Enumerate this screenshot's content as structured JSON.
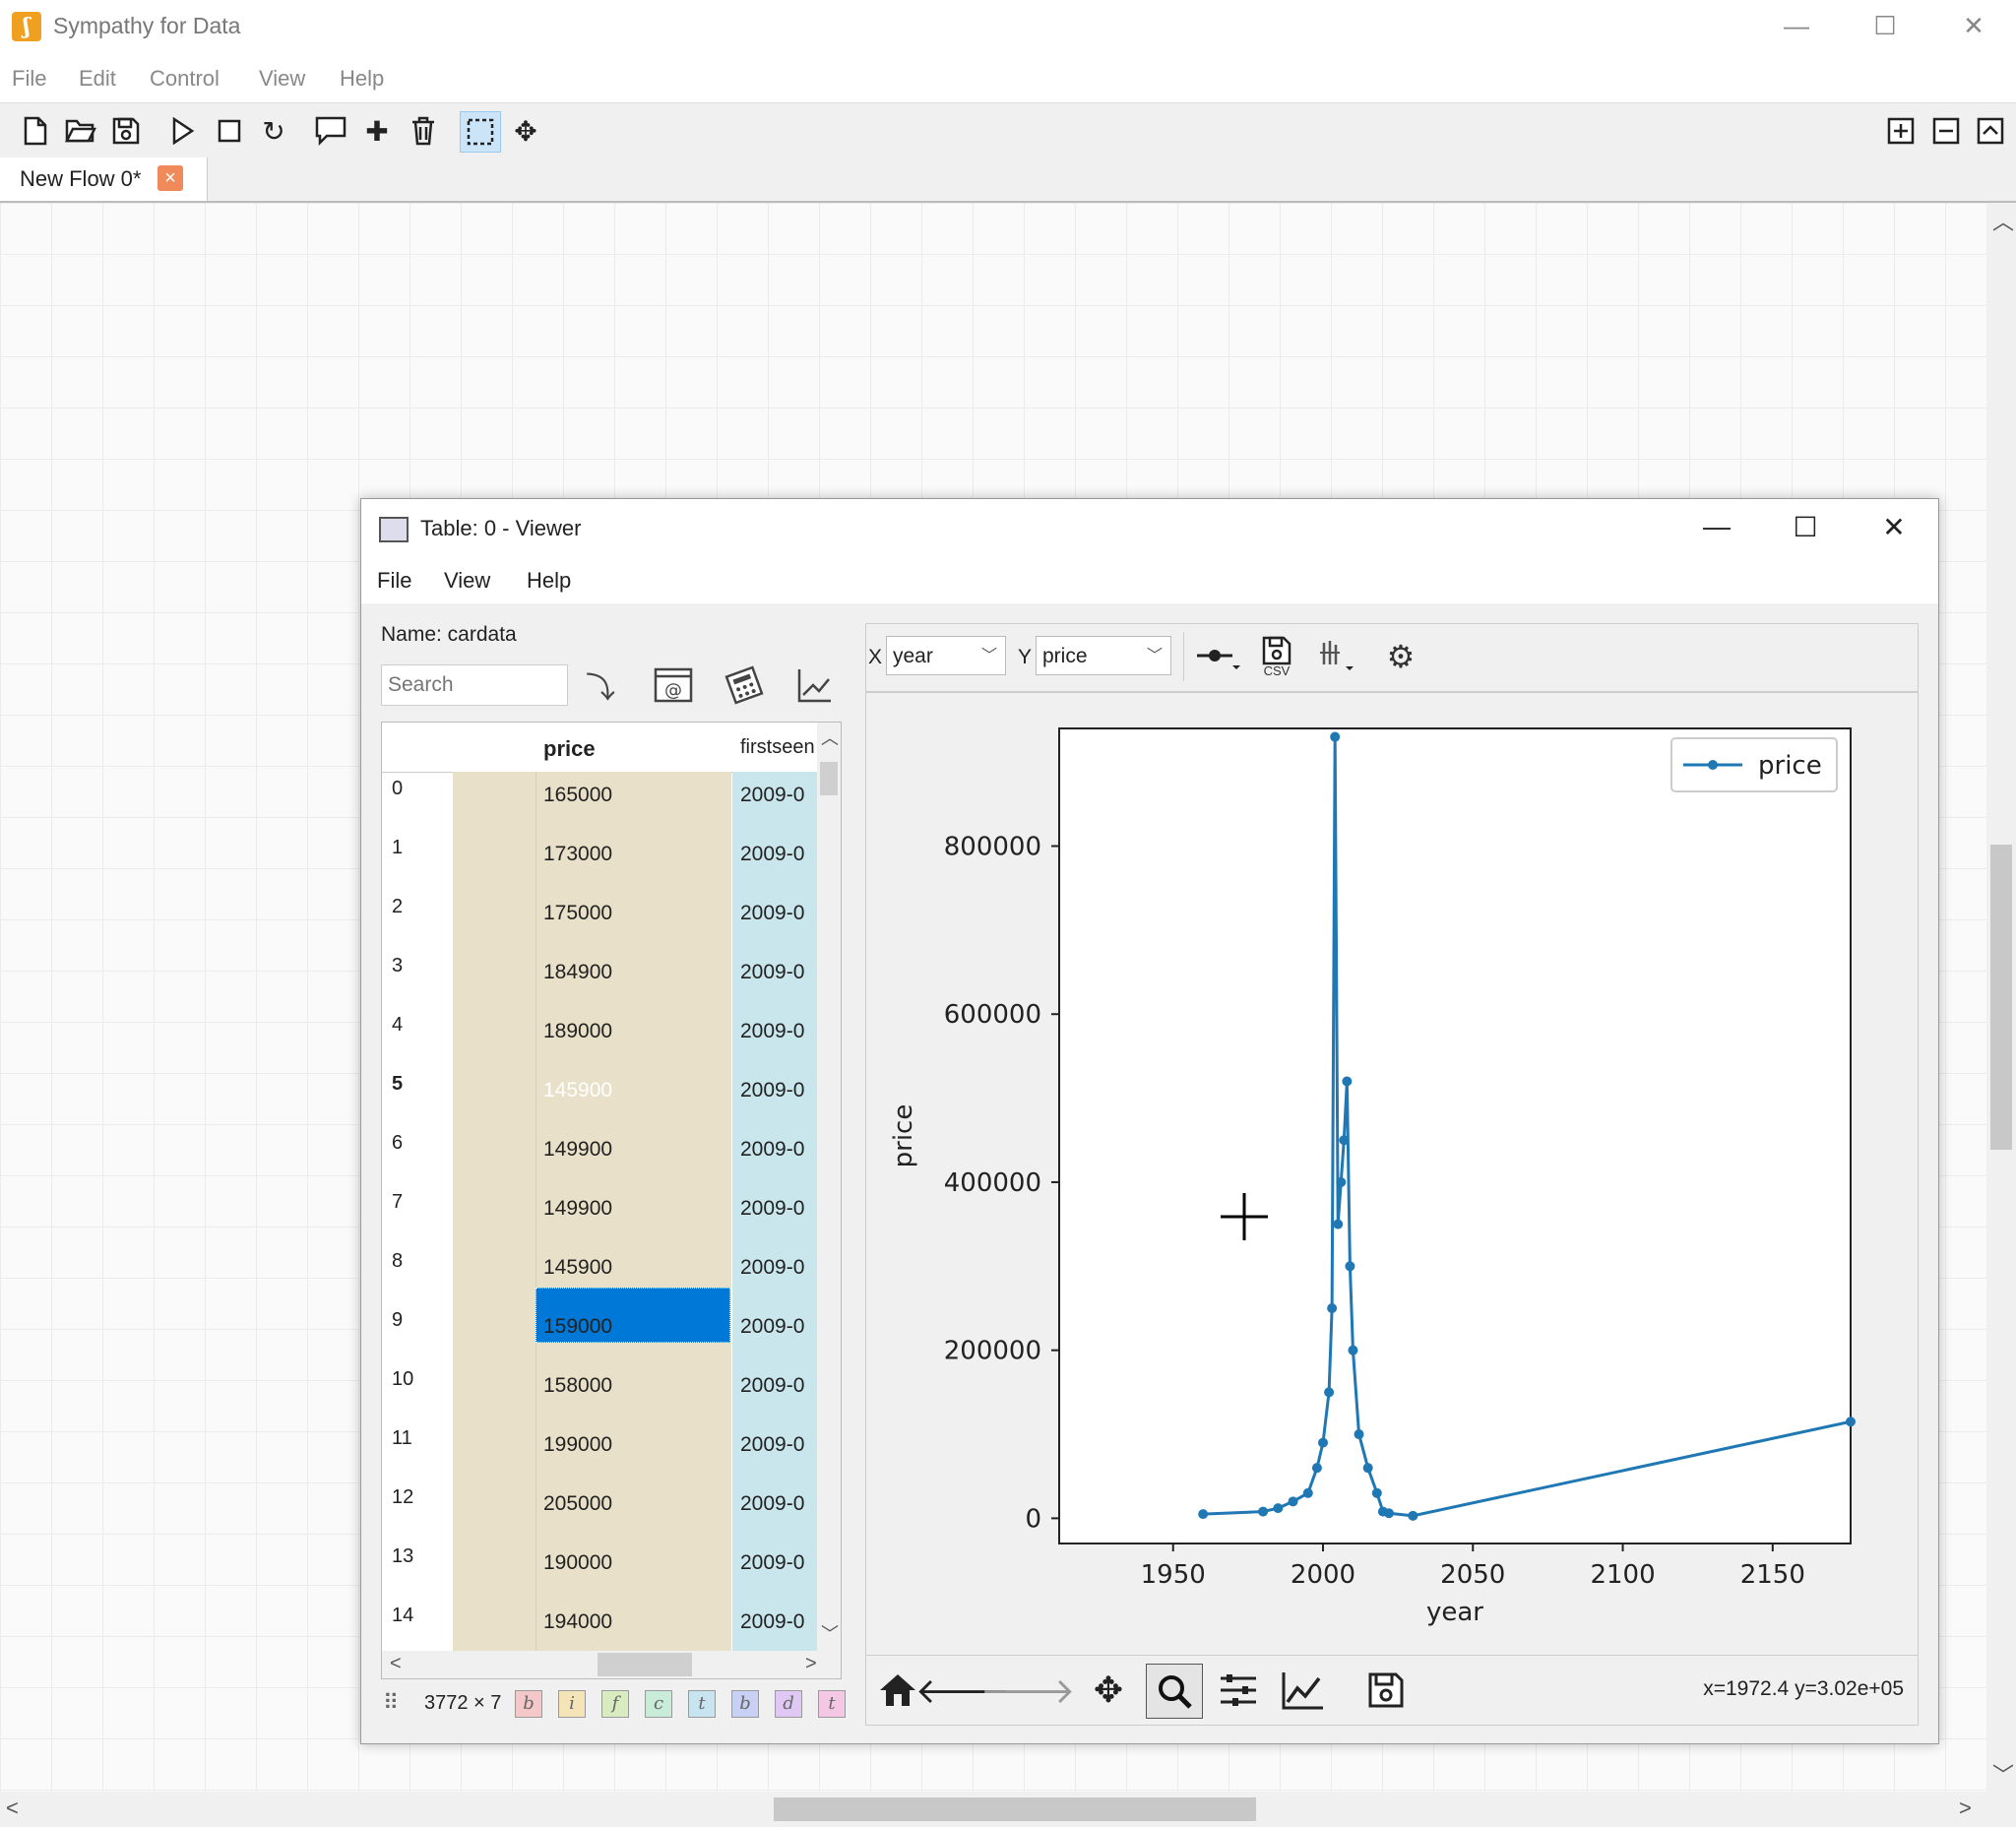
{
  "app": {
    "title": "Sympathy for Data",
    "icon_letter": "ʃ",
    "menu": [
      "File",
      "Edit",
      "Control",
      "View",
      "Help"
    ],
    "tab": {
      "label": "New Flow 0*",
      "close": "×"
    }
  },
  "viewer": {
    "title": "Table: 0 - Viewer",
    "menu": [
      "File",
      "View",
      "Help"
    ],
    "name_label": "Name: cardata",
    "search_placeholder": "Search",
    "columns": {
      "price": "price",
      "firstseen": "firstseen"
    },
    "rows": [
      {
        "idx": "0",
        "price": "165000",
        "firstseen": "2009-0"
      },
      {
        "idx": "1",
        "price": "173000",
        "firstseen": "2009-0"
      },
      {
        "idx": "2",
        "price": "175000",
        "firstseen": "2009-0"
      },
      {
        "idx": "3",
        "price": "184900",
        "firstseen": "2009-0"
      },
      {
        "idx": "4",
        "price": "189000",
        "firstseen": "2009-0"
      },
      {
        "idx": "5",
        "price": "145900",
        "firstseen": "2009-0"
      },
      {
        "idx": "6",
        "price": "149900",
        "firstseen": "2009-0"
      },
      {
        "idx": "7",
        "price": "149900",
        "firstseen": "2009-0"
      },
      {
        "idx": "8",
        "price": "145900",
        "firstseen": "2009-0"
      },
      {
        "idx": "9",
        "price": "159000",
        "firstseen": "2009-0"
      },
      {
        "idx": "10",
        "price": "158000",
        "firstseen": "2009-0"
      },
      {
        "idx": "11",
        "price": "199000",
        "firstseen": "2009-0"
      },
      {
        "idx": "12",
        "price": "205000",
        "firstseen": "2009-0"
      },
      {
        "idx": "13",
        "price": "190000",
        "firstseen": "2009-0"
      },
      {
        "idx": "14",
        "price": "194000",
        "firstseen": "2009-0"
      }
    ],
    "selected_row": "5",
    "dims": "3772 × 7",
    "type_badges": [
      {
        "letter": "b",
        "color": "#f4c8c8"
      },
      {
        "letter": "i",
        "color": "#f4e4b8"
      },
      {
        "letter": "f",
        "color": "#d8ecc0"
      },
      {
        "letter": "c",
        "color": "#c8ecd8"
      },
      {
        "letter": "t",
        "color": "#c8e4f0"
      },
      {
        "letter": "b",
        "color": "#c8d0f4"
      },
      {
        "letter": "d",
        "color": "#e0c8f4"
      },
      {
        "letter": "t",
        "color": "#f4c8e4"
      }
    ]
  },
  "plot": {
    "x_label": "X",
    "y_label": "Y",
    "x_value": "year",
    "y_value": "price",
    "csv_label": "CSV",
    "coord_readout": "x=1972.4 y=3.02e+05"
  },
  "chart_data": {
    "type": "line",
    "xlabel": "year",
    "ylabel": "price",
    "xlim": [
      1912,
      2176
    ],
    "ylim": [
      -30000,
      940000
    ],
    "xticks": [
      1950,
      2000,
      2050,
      2100,
      2150
    ],
    "yticks": [
      0,
      200000,
      400000,
      600000,
      800000
    ],
    "series": [
      {
        "name": "price",
        "color": "#1f77b4",
        "points": [
          [
            1960,
            5000
          ],
          [
            1980,
            8000
          ],
          [
            1985,
            12000
          ],
          [
            1990,
            20000
          ],
          [
            1995,
            30000
          ],
          [
            1998,
            60000
          ],
          [
            2000,
            90000
          ],
          [
            2002,
            150000
          ],
          [
            2003,
            250000
          ],
          [
            2004,
            930000
          ],
          [
            2005,
            350000
          ],
          [
            2006,
            400000
          ],
          [
            2007,
            450000
          ],
          [
            2008,
            520000
          ],
          [
            2009,
            300000
          ],
          [
            2010,
            200000
          ],
          [
            2012,
            100000
          ],
          [
            2015,
            60000
          ],
          [
            2018,
            30000
          ],
          [
            2020,
            8000
          ],
          [
            2022,
            6000
          ],
          [
            2030,
            3000
          ],
          [
            2176,
            115000
          ]
        ]
      }
    ],
    "legend": "top-right"
  }
}
